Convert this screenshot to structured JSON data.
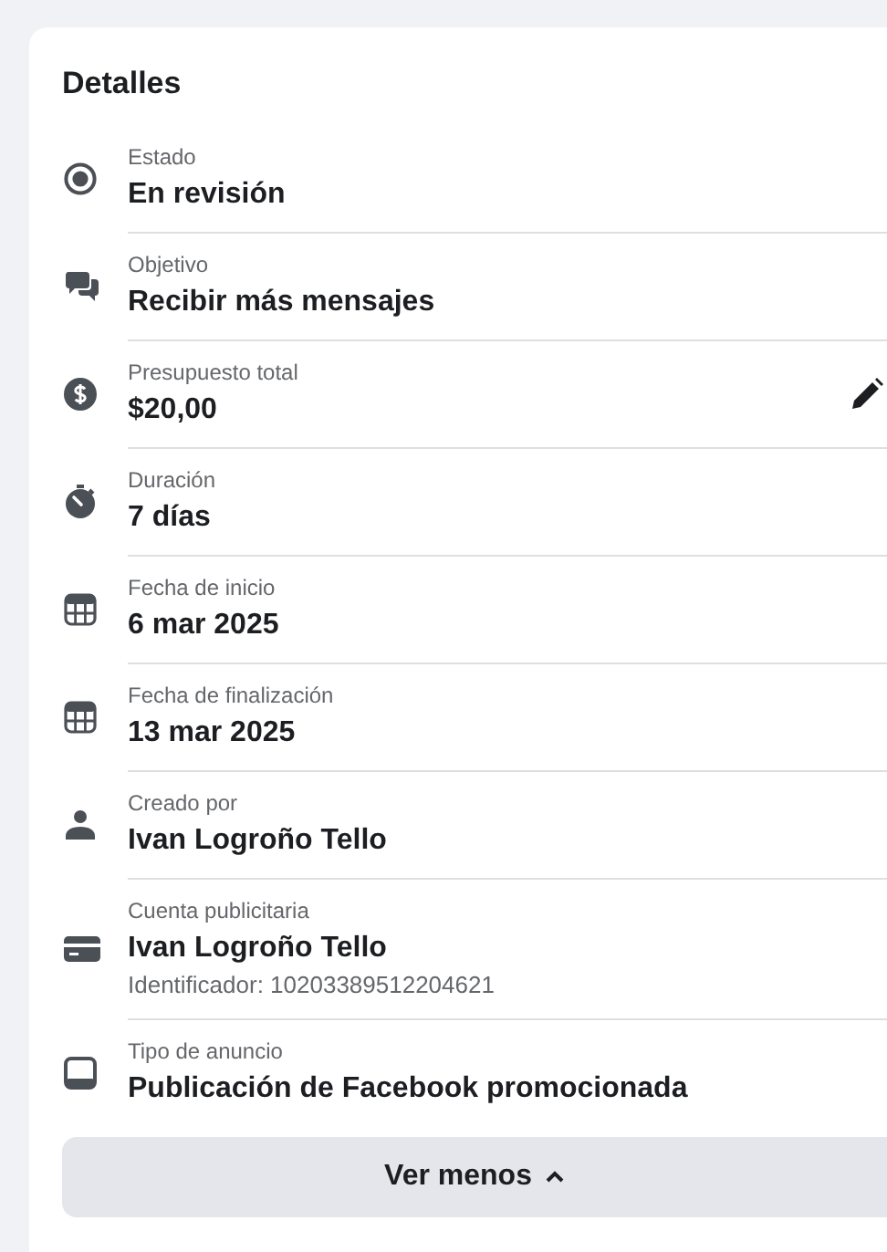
{
  "card": {
    "title": "Detalles",
    "rows": [
      {
        "kind": "status",
        "label": "Estado",
        "value": "En revisión"
      },
      {
        "kind": "chat",
        "label": "Objetivo",
        "value": "Recibir más mensajes"
      },
      {
        "kind": "money",
        "label": "Presupuesto total",
        "value": "$20,00",
        "editable": true
      },
      {
        "kind": "timer",
        "label": "Duración",
        "value": "7 días"
      },
      {
        "kind": "calendar",
        "label": "Fecha de inicio",
        "value": "6 mar 2025"
      },
      {
        "kind": "calendar",
        "label": "Fecha de finalización",
        "value": "13 mar 2025"
      },
      {
        "kind": "person",
        "label": "Creado por",
        "value": "Ivan Logroño Tello"
      },
      {
        "kind": "card",
        "label": "Cuenta publicitaria",
        "value": "Ivan Logroño Tello",
        "detail": "Identificador: 10203389512204621"
      },
      {
        "kind": "device",
        "label": "Tipo de anuncio",
        "value": "Publicación de Facebook promocionada"
      }
    ],
    "button": {
      "label": "Ver menos"
    }
  }
}
